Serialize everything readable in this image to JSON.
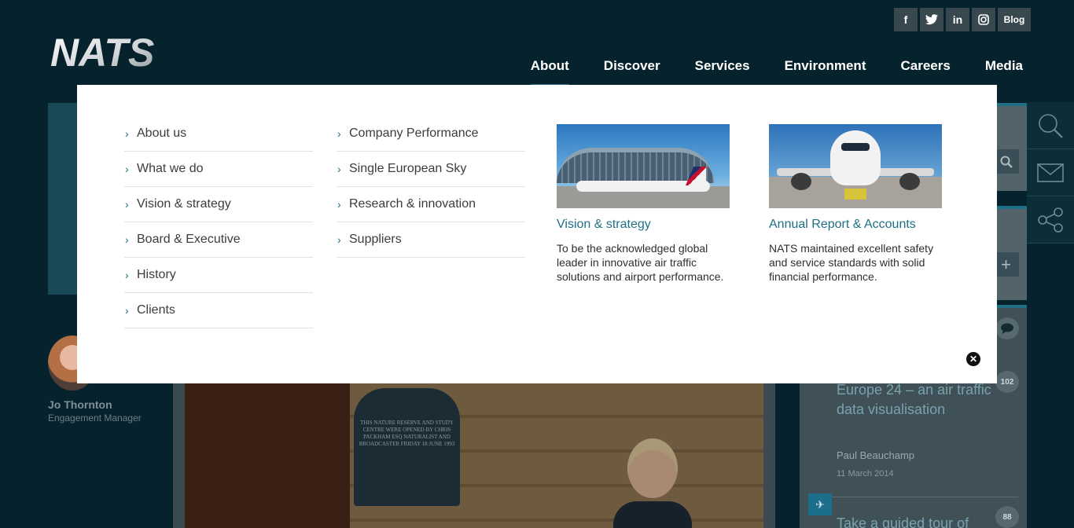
{
  "brand": {
    "logo_text": "NATS"
  },
  "social": {
    "facebook": "f",
    "twitter": "t",
    "linkedin": "in",
    "instagram": "ig",
    "blog": "Blog"
  },
  "nav": {
    "items": [
      {
        "label": "About",
        "active": true
      },
      {
        "label": "Discover",
        "active": false
      },
      {
        "label": "Services",
        "active": false
      },
      {
        "label": "Environment",
        "active": false
      },
      {
        "label": "Careers",
        "active": false
      },
      {
        "label": "Media",
        "active": false
      }
    ]
  },
  "mega_menu": {
    "column1": [
      "About us",
      "What we do",
      "Vision & strategy",
      "Board & Executive",
      "History",
      "Clients"
    ],
    "column2": [
      "Company Performance",
      "Single European Sky",
      "Research & innovation",
      "Suppliers"
    ],
    "features": [
      {
        "title": "Vision & strategy",
        "description": "To be the acknowledged global leader in innovative air traffic solutions and airport performance."
      },
      {
        "title": "Annual Report & Accounts",
        "description": "NATS maintained excellent safety and service standards with solid financial performance."
      }
    ]
  },
  "author": {
    "name": "Jo Thornton",
    "role": "Engagement Manager"
  },
  "plaque_text": "THIS NATURE RESERVE AND STUDY CENTRE WERE OPENED BY CHRIS PACKHAM ESQ NATURALIST AND BROADCASTER FRIDAY 18 JUNE 1993",
  "feed": {
    "post1": {
      "title": "Europe 24 – an air traffic data visualisation",
      "author": "Paul Beauchamp",
      "date": "11 March 2014",
      "comments": "102"
    },
    "post2": {
      "title": "Take a guided tour of",
      "comments": "88"
    }
  },
  "colors": {
    "accent": "#1f6f86",
    "header_bg": "#06222c"
  }
}
